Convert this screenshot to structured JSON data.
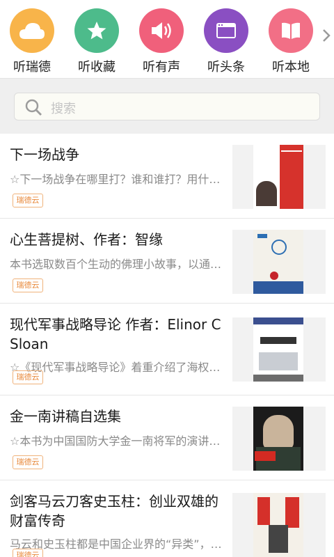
{
  "nav": {
    "items": [
      {
        "label": "听瑞德",
        "icon": "cloud-icon",
        "color": "#f8b44a"
      },
      {
        "label": "听收藏",
        "icon": "star-icon",
        "color": "#4dbb8b"
      },
      {
        "label": "听有声",
        "icon": "speaker-icon",
        "color": "#f0607b"
      },
      {
        "label": "听头条",
        "icon": "browser-window-icon",
        "color": "#8a4fc2"
      },
      {
        "label": "听本地",
        "icon": "book-icon",
        "color": "#f26f86"
      }
    ],
    "more_icon": "chevron-right-icon"
  },
  "search": {
    "placeholder": "搜索"
  },
  "books": [
    {
      "title": "下一场战争",
      "desc": "☆下一场战争在哪里打？谁和谁打？用什么…",
      "tag": "瑞德云"
    },
    {
      "title": "心生菩提树、作者：智缘",
      "desc": "本书选取数百个生动的佛理小故事，以通俗…",
      "tag": "瑞德云"
    },
    {
      "title": "现代军事战略导论 作者：Elinor C Sloan",
      "desc": "☆《现代军事战略导论》着重介绍了海权、…",
      "tag": "瑞德云"
    },
    {
      "title": "金一南讲稿自选集",
      "desc": "☆本书为中国国防大学金一南将军的演讲稿…",
      "tag": "瑞德云"
    },
    {
      "title": "剑客马云刀客史玉柱：创业双雄的财富传奇",
      "desc": "马云和史玉柱都是中国企业界的“异类”，都…",
      "tag": "瑞德云"
    }
  ],
  "colors": {
    "accent": "#e8893b",
    "divider": "#e6e6e6"
  }
}
